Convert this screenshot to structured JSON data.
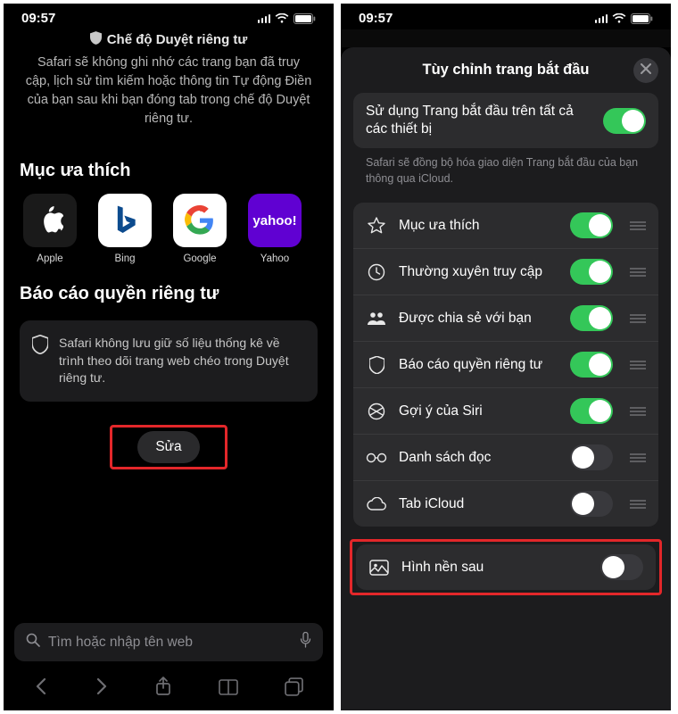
{
  "status": {
    "time": "09:57"
  },
  "left": {
    "private_mode_title": "Chế độ Duyệt riêng tư",
    "private_mode_desc": "Safari sẽ không ghi nhớ các trang bạn đã truy cập, lịch sử tìm kiếm hoặc thông tin Tự động Điền của bạn sau khi bạn đóng tab trong chế độ Duyệt riêng tư.",
    "favorites_heading": "Mục ưa thích",
    "favorites": [
      {
        "label": "Apple"
      },
      {
        "label": "Bing"
      },
      {
        "label": "Google"
      },
      {
        "label": "Yahoo",
        "tile_text": "yahoo!"
      }
    ],
    "privacy_report_heading": "Báo cáo quyền riêng tư",
    "privacy_report_text": "Safari không lưu giữ số liệu thống kê về trình theo dõi trang web chéo trong Duyệt riêng tư.",
    "edit_button": "Sửa",
    "search_placeholder": "Tìm hoặc nhập tên web"
  },
  "right": {
    "sheet_title": "Tùy chỉnh trang bắt đầu",
    "sync_row_label": "Sử dụng Trang bắt đầu trên tất cả các thiết bị",
    "sync_note": "Safari sẽ đồng bộ hóa giao diện Trang bắt đầu của bạn thông qua iCloud.",
    "options": [
      {
        "icon": "star",
        "label": "Mục ưa thích",
        "on": true
      },
      {
        "icon": "clock",
        "label": "Thường xuyên truy cập",
        "on": true
      },
      {
        "icon": "people",
        "label": "Được chia sẻ với bạn",
        "on": true
      },
      {
        "icon": "shield",
        "label": "Báo cáo quyền riêng tư",
        "on": true
      },
      {
        "icon": "siri",
        "label": "Gợi ý của Siri",
        "on": true
      },
      {
        "icon": "glasses",
        "label": "Danh sách đọc",
        "on": false
      },
      {
        "icon": "cloud",
        "label": "Tab iCloud",
        "on": false
      }
    ],
    "bg_image_label": "Hình nền sau"
  }
}
